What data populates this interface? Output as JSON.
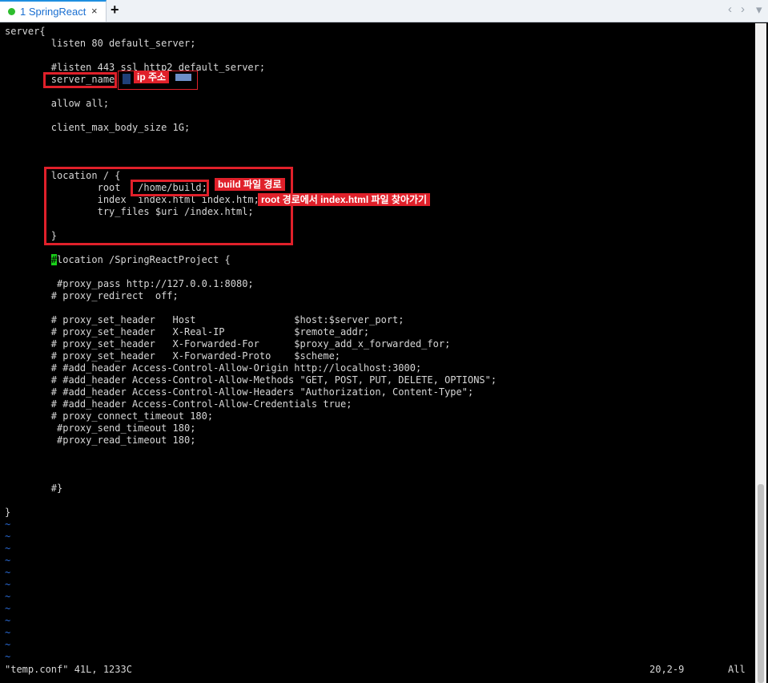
{
  "tabbar": {
    "tab_label": "1 SpringReact",
    "close_glyph": "×",
    "add_glyph": "+",
    "prev_glyph": "‹",
    "next_glyph": "›",
    "menu_glyph": "▾",
    "active_color": "#1a6fd1",
    "status_dot_color": "#2dbd2d"
  },
  "editor": {
    "lines": [
      "server{",
      "        listen 80 default_server;",
      "",
      "        #listen 443 ssl http2 default_server;",
      "        server_name",
      "",
      "        allow all;",
      "",
      "        client_max_body_size 1G;",
      "",
      "",
      "",
      "        location / {",
      "                root   /home/build;",
      "                index  index.html index.htm;",
      "                try_files $uri /index.html;",
      "",
      "        }",
      "",
      "",
      "         #proxy_pass http://127.0.0.1:8080;",
      "        # proxy_redirect  off;",
      "",
      "        # proxy_set_header   Host                 $host:$server_port;",
      "        # proxy_set_header   X-Real-IP            $remote_addr;",
      "        # proxy_set_header   X-Forwarded-For      $proxy_add_x_forwarded_for;",
      "        # proxy_set_header   X-Forwarded-Proto    $scheme;",
      "        # #add_header Access-Control-Allow-Origin http://localhost:3000;",
      "        # #add_header Access-Control-Allow-Methods \"GET, POST, PUT, DELETE, OPTIONS\";",
      "        # #add_header Access-Control-Allow-Headers \"Authorization, Content-Type\";",
      "        # #add_header Access-Control-Allow-Credentials true;",
      "        # proxy_connect_timeout 180;",
      "         #proxy_send_timeout 180;",
      "         #proxy_read_timeout 180;",
      "",
      "",
      "",
      "        #}",
      "",
      "}"
    ],
    "cursor_line": {
      "indent": "        ",
      "cursor_char": "#",
      "rest": "location /SpringReactProject {"
    },
    "tilde": "~",
    "tilde_count": 12,
    "tilde_color": "#2b6cd8",
    "cursor_color": "#19d219"
  },
  "status": {
    "file": "\"temp.conf\" 41L, 1233C",
    "position": "20,2-9",
    "scroll": "All"
  },
  "annotations": {
    "ip_label": "ip 주소",
    "build_label": "build 파일 경로",
    "root_label": "root 경로에서 index.html 파일 찾아가기",
    "color": "#e0202a"
  }
}
